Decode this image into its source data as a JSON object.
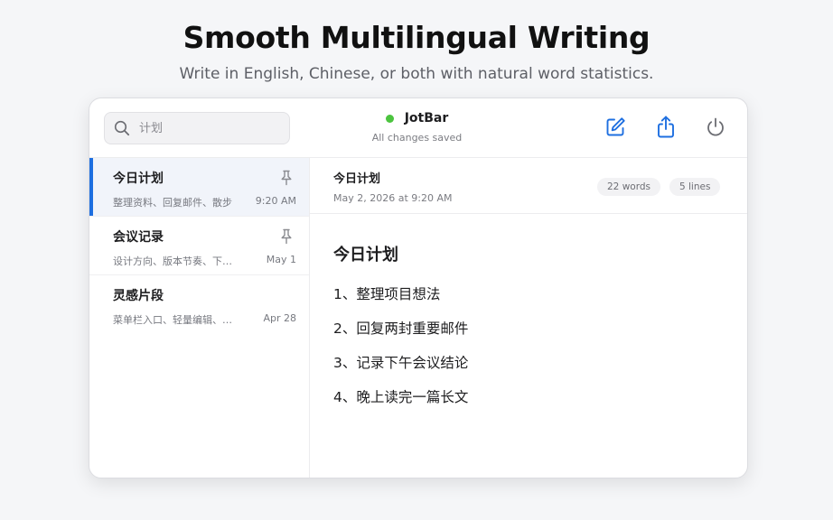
{
  "hero": {
    "title": "Smooth Multilingual Writing",
    "subtitle": "Write in English, Chinese, or both with natural word statistics."
  },
  "topbar": {
    "search": {
      "value": "",
      "placeholder": "计划",
      "icon": "search-icon"
    },
    "app_name": "JotBar",
    "status_color": "#4cc43f",
    "save_status": "All changes saved",
    "actions": [
      {
        "name": "new-note",
        "icon": "compose-icon"
      },
      {
        "name": "share",
        "icon": "share-icon"
      },
      {
        "name": "quit",
        "icon": "power-icon"
      }
    ],
    "accent": "#1e6fe0"
  },
  "notes": [
    {
      "title": "今日计划",
      "preview": "整理资料、回复邮件、散步",
      "time": "9:20 AM",
      "pinned": true,
      "active": true
    },
    {
      "title": "会议记录",
      "preview": "设计方向、版本节奏、下…",
      "time": "May 1",
      "pinned": true,
      "active": false
    },
    {
      "title": "灵感片段",
      "preview": "菜单栏入口、轻量编辑、…",
      "time": "Apr 28",
      "pinned": false,
      "active": false
    }
  ],
  "editor": {
    "title": "今日计划",
    "date": "May 2, 2026 at 9:20 AM",
    "word_count": "22 words",
    "line_count": "5 lines",
    "heading": "今日计划",
    "lines": [
      "1、整理项目想法",
      "2、回复两封重要邮件",
      "3、记录下午会议结论",
      "4、晚上读完一篇长文"
    ]
  }
}
